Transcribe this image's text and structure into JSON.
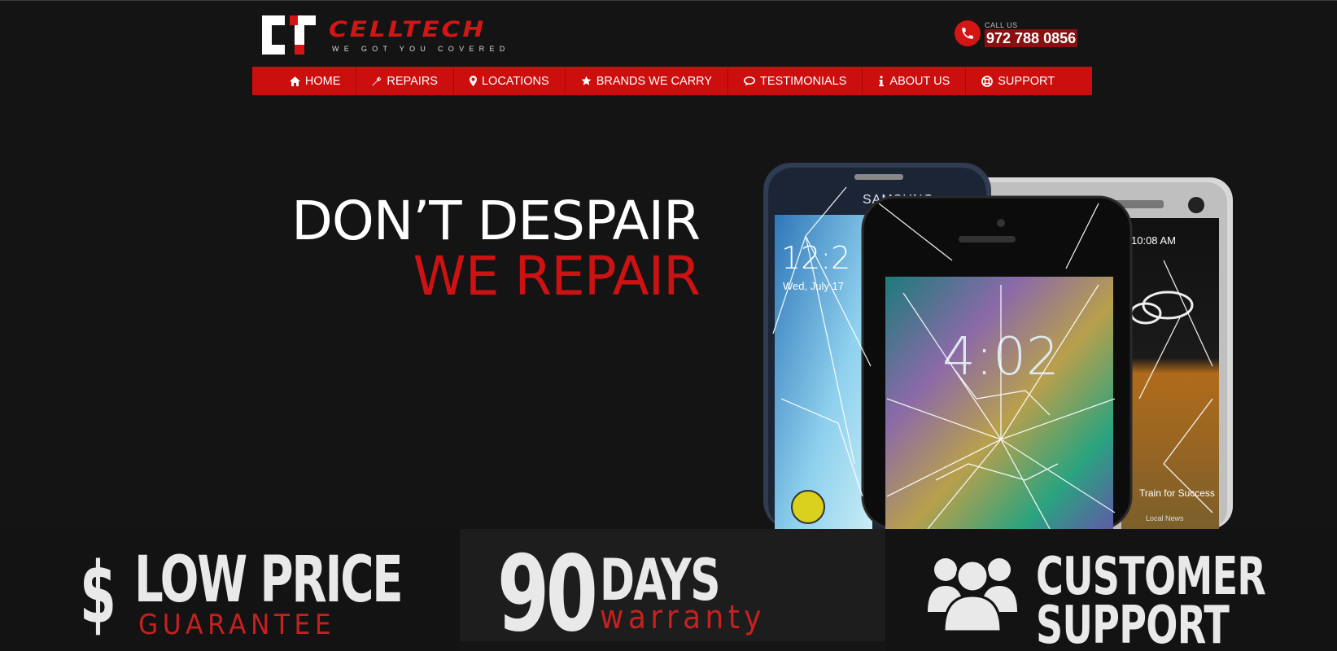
{
  "brand": {
    "name": "CELLTECH",
    "tagline": "WE GOT YOU COVERED"
  },
  "contact": {
    "label": "CALL US",
    "phone": "972 788 0856"
  },
  "nav": [
    {
      "label": "HOME",
      "icon": "home-icon"
    },
    {
      "label": "REPAIRS",
      "icon": "wrench-icon"
    },
    {
      "label": "LOCATIONS",
      "icon": "map-pin-icon"
    },
    {
      "label": "BRANDS WE CARRY",
      "icon": "star-icon"
    },
    {
      "label": "TESTIMONIALS",
      "icon": "chat-icon"
    },
    {
      "label": "ABOUT US",
      "icon": "info-icon"
    },
    {
      "label": "SUPPORT",
      "icon": "lifebuoy-icon"
    }
  ],
  "hero": {
    "line1": "DON’T DESPAIR",
    "line2": "WE REPAIR",
    "phone_screens": {
      "left_time": "12:2",
      "left_date": "Wed, July 17",
      "center_time": "4:02",
      "right_time": "10:08 AM",
      "right_caption": "Train for Success",
      "right_sub": "Local News",
      "brand_text": "SAMSUNG"
    }
  },
  "features": {
    "price": {
      "symbol": "$",
      "line1": "LOW PRICE",
      "line2": "GUARANTEE"
    },
    "warranty": {
      "number": "90",
      "line1": "DAYS",
      "line2": "warranty"
    },
    "support": {
      "line1": "CUSTOMER",
      "line2": "SUPPORT"
    }
  },
  "colors": {
    "accent": "#cc0e0e",
    "background": "#141414",
    "text": "#ffffff"
  }
}
